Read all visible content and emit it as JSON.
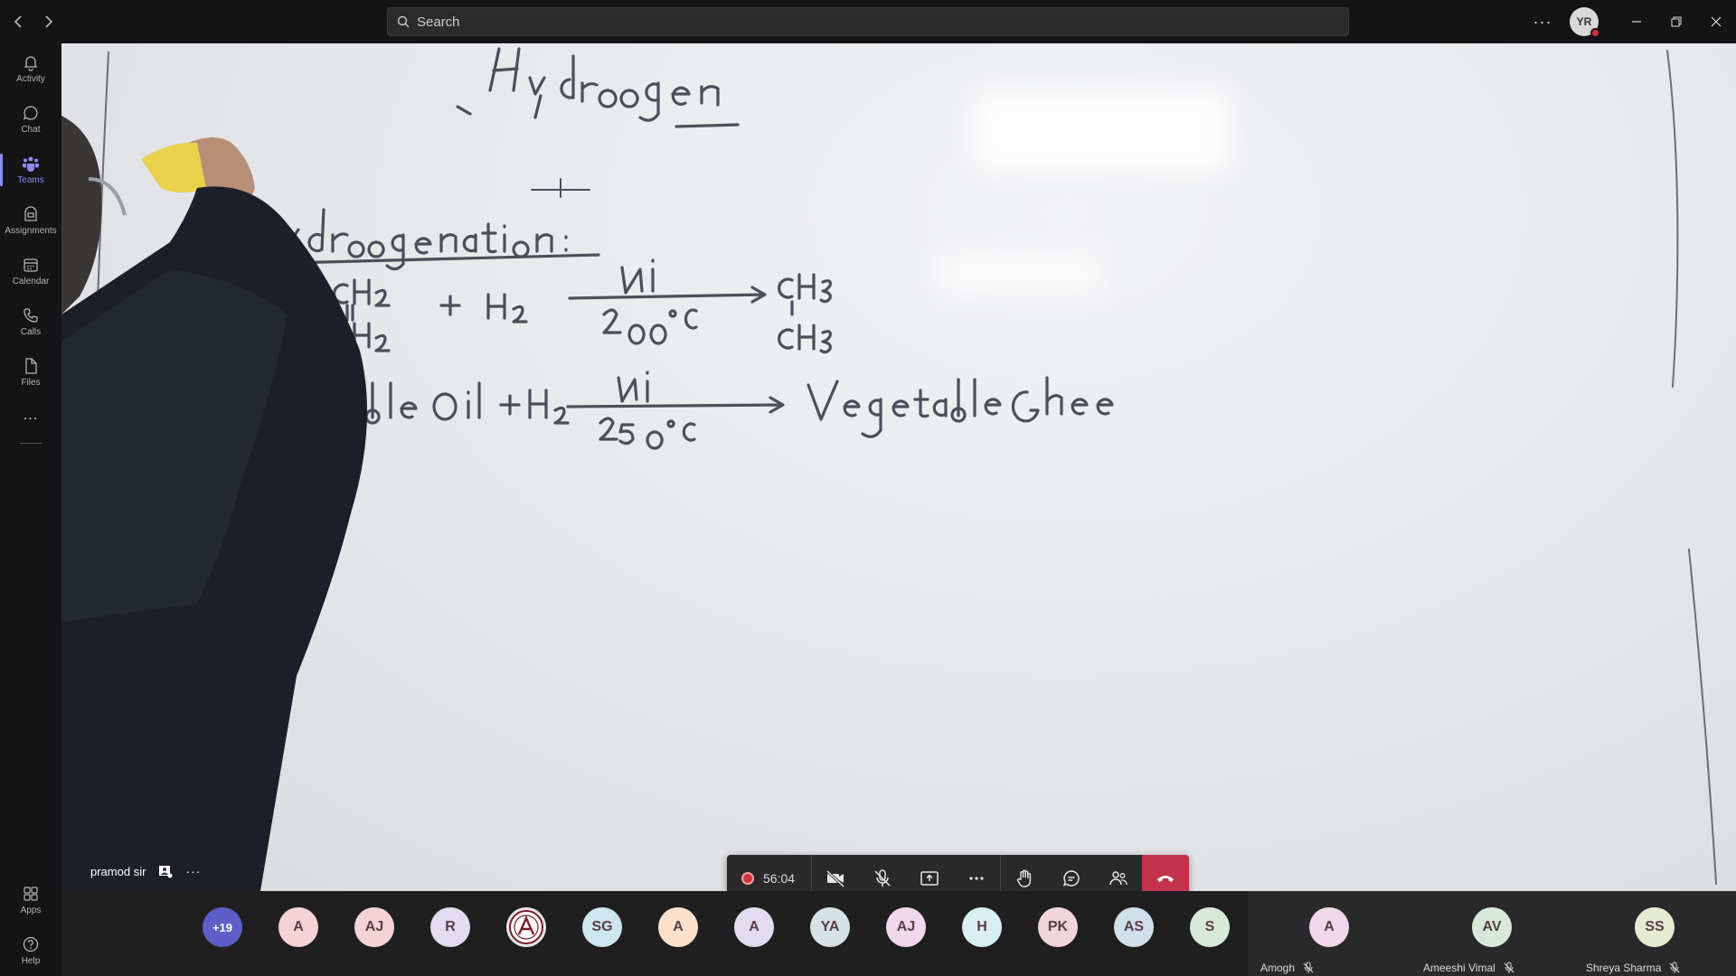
{
  "topbar": {
    "search_placeholder": "Search",
    "user_initials": "YR"
  },
  "rail": {
    "items": [
      {
        "label": "Activity",
        "icon": "bell-icon"
      },
      {
        "label": "Chat",
        "icon": "chat-icon"
      },
      {
        "label": "Teams",
        "icon": "teams-icon",
        "active": true
      },
      {
        "label": "Assignments",
        "icon": "assignments-icon"
      },
      {
        "label": "Calendar",
        "icon": "calendar-icon"
      },
      {
        "label": "Calls",
        "icon": "phone-icon"
      },
      {
        "label": "Files",
        "icon": "file-icon"
      }
    ],
    "more": "...",
    "apps": "Apps",
    "help": "Help"
  },
  "stage": {
    "speaker_name": "pramod sir"
  },
  "controls": {
    "timer": "56:04"
  },
  "participants": {
    "overflow": "+19",
    "avatars": [
      {
        "initials": "A",
        "bg": "#f4d3d6"
      },
      {
        "initials": "AJ",
        "bg": "#f4d3d6"
      },
      {
        "initials": "R",
        "bg": "#e1dcef"
      },
      {
        "initials": "",
        "bg": "#e8e8e8",
        "logo": true
      },
      {
        "initials": "SG",
        "bg": "#cde6ef"
      },
      {
        "initials": "A",
        "bg": "#fbe1cc"
      },
      {
        "initials": "A",
        "bg": "#e1dcef"
      },
      {
        "initials": "YA",
        "bg": "#d5e2e6"
      },
      {
        "initials": "AJ",
        "bg": "#f1d7ea"
      },
      {
        "initials": "H",
        "bg": "#d7eef3"
      },
      {
        "initials": "PK",
        "bg": "#f2d5da"
      },
      {
        "initials": "AS",
        "bg": "#d0e0ea"
      },
      {
        "initials": "S",
        "bg": "#d7ead9"
      }
    ],
    "tiles": [
      {
        "initials": "A",
        "name": "Amogh",
        "bg": "#f1d7ea"
      },
      {
        "initials": "AV",
        "name": "Ameeshi Vimal",
        "bg": "#d7ead9"
      },
      {
        "initials": "SS",
        "name": "Shreya Sharma",
        "bg": "#e5ebd3"
      }
    ]
  }
}
